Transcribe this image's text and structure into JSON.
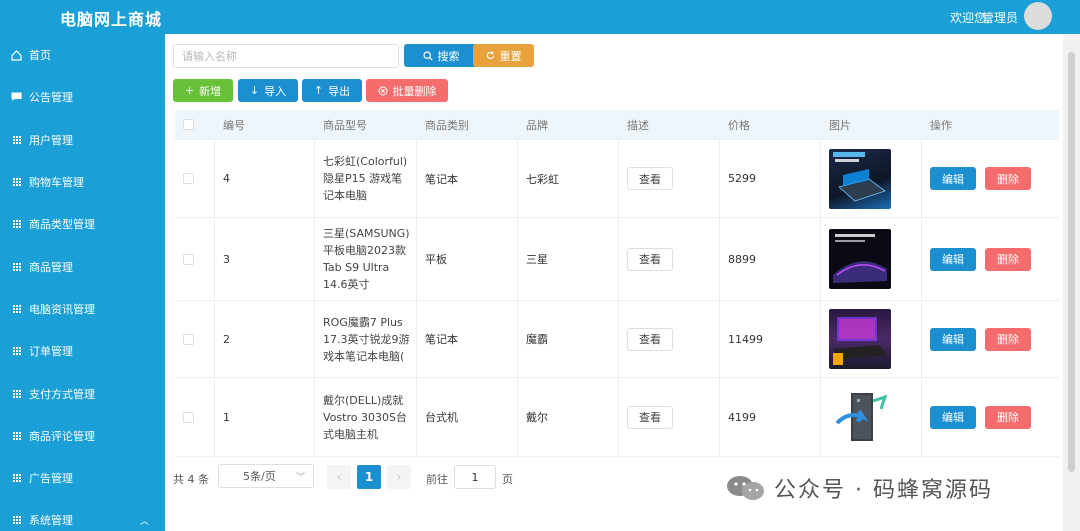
{
  "header": {
    "app_title": "电脑网上商城",
    "welcome": "欢迎您,",
    "user": "管理员"
  },
  "sidebar": {
    "items": [
      {
        "label": "首页",
        "icon": "home-icon"
      },
      {
        "label": "公告管理",
        "icon": "message-icon"
      },
      {
        "label": "用户管理",
        "icon": "grid-icon"
      },
      {
        "label": "购物车管理",
        "icon": "grid-icon"
      },
      {
        "label": "商品类型管理",
        "icon": "grid-icon"
      },
      {
        "label": "商品管理",
        "icon": "grid-icon"
      },
      {
        "label": "电脑资讯管理",
        "icon": "grid-icon"
      },
      {
        "label": "订单管理",
        "icon": "grid-icon"
      },
      {
        "label": "支付方式管理",
        "icon": "grid-icon"
      },
      {
        "label": "商品评论管理",
        "icon": "grid-icon"
      },
      {
        "label": "广告管理",
        "icon": "grid-icon"
      },
      {
        "label": "系统管理",
        "icon": "grid-icon"
      }
    ]
  },
  "toolbar": {
    "search_placeholder": "请输入名称",
    "search_label": "搜索",
    "reset_label": "重置",
    "add_label": "新增",
    "import_label": "导入",
    "export_label": "导出",
    "batch_delete_label": "批量删除"
  },
  "table": {
    "headers": [
      "编号",
      "商品型号",
      "商品类别",
      "品牌",
      "描述",
      "价格",
      "图片",
      "操作"
    ],
    "view_label": "查看",
    "edit_label": "编辑",
    "delete_label": "删除",
    "rows": [
      {
        "id": "4",
        "model": "七彩虹(Colorful)隐星P15 游戏笔记本电脑",
        "category": "笔记本",
        "brand": "七彩虹",
        "price": "5299"
      },
      {
        "id": "3",
        "model": "三星(SAMSUNG)平板电脑2023款Tab S9 Ultra 14.6英寸",
        "category": "平板",
        "brand": "三星",
        "price": "8899"
      },
      {
        "id": "2",
        "model": "ROG魔霸7 Plus 17.3英寸锐龙9游戏本笔记本电脑(",
        "category": "笔记本",
        "brand": "魔霸",
        "price": "11499"
      },
      {
        "id": "1",
        "model": "戴尔(DELL)成就Vostro 3030S台式电脑主机",
        "category": "台式机",
        "brand": "戴尔",
        "price": "4199"
      }
    ]
  },
  "pagination": {
    "total": "共 4 条",
    "page_size": "5条/页",
    "current_page": "1",
    "goto_label": "前往",
    "goto_value": "1",
    "page_suffix": "页"
  },
  "watermark": {
    "text": "公众号 · 码蜂窝源码"
  },
  "colors": {
    "primary": "#1a9fd6",
    "button_blue": "#1c8fd0",
    "success": "#67c23a",
    "warning": "#e8a33e",
    "danger": "#f56c6c"
  }
}
